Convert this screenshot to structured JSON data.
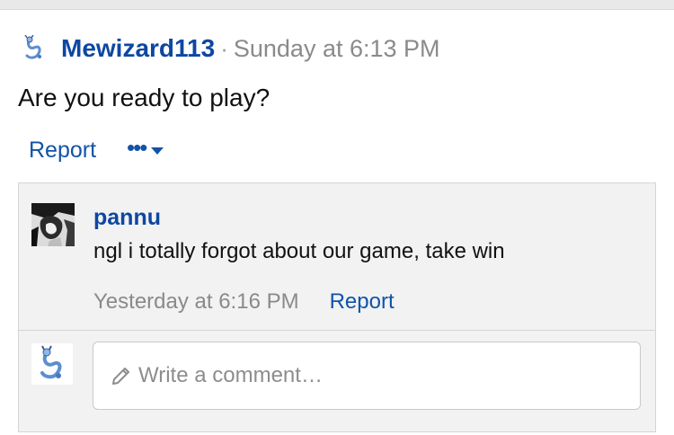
{
  "post": {
    "author": "Mewizard113",
    "separator": "·",
    "timestamp": "Sunday at 6:13 PM",
    "message": "Are you ready to play?",
    "report_label": "Report",
    "more_label": "•••"
  },
  "comments": [
    {
      "author": "pannu",
      "text": "ngl i totally forgot about our game, take win",
      "timestamp": "Yesterday at 6:16 PM",
      "report_label": "Report"
    }
  ],
  "reply": {
    "placeholder": "Write a comment…"
  },
  "colors": {
    "link": "#1153a8",
    "username": "#0d47a1",
    "muted": "#8a8a8a"
  },
  "icons": [
    "dragonair-avatar-icon",
    "pencil-icon",
    "chevron-down-icon"
  ]
}
